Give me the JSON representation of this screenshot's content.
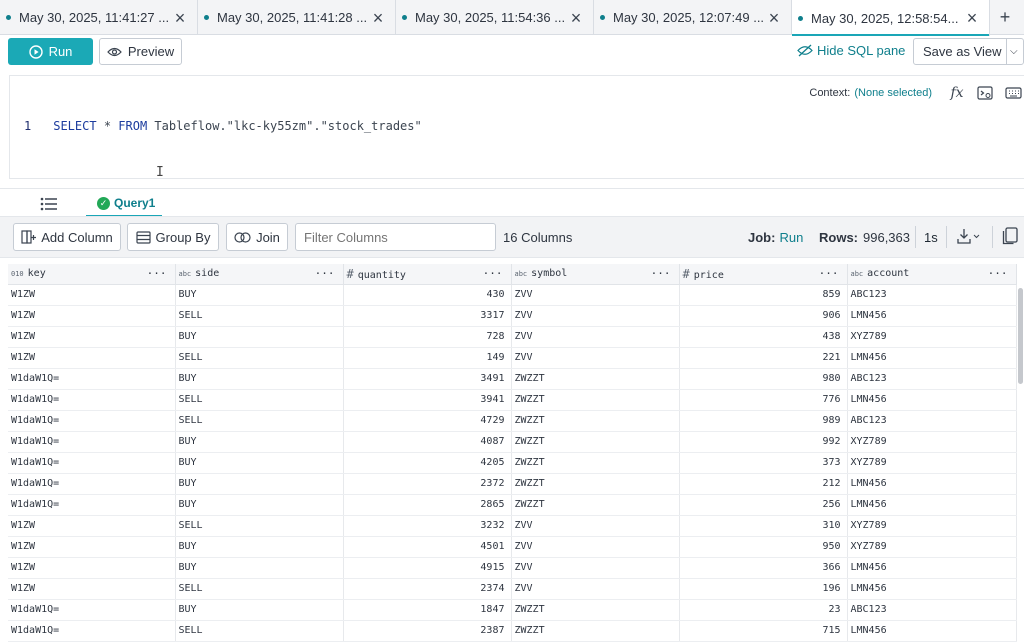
{
  "tabs": [
    {
      "label": "May 30, 2025, 11:41:27 ...",
      "active": false
    },
    {
      "label": "May 30, 2025, 11:41:28 ...",
      "active": false
    },
    {
      "label": "May 30, 2025, 11:54:36 ...",
      "active": false
    },
    {
      "label": "May 30, 2025, 12:07:49 ...",
      "active": false
    },
    {
      "label": "May 30, 2025, 12:58:54...",
      "active": true
    }
  ],
  "toolbar": {
    "run_label": "Run",
    "preview_label": "Preview",
    "hide_sql_label": "Hide SQL pane",
    "save_view_label": "Save as View"
  },
  "editor": {
    "context_label": "Context:",
    "context_value": "(None selected)",
    "line_number": "1",
    "sql_keyword_select": "SELECT",
    "sql_star": " * ",
    "sql_keyword_from": "FROM",
    "sql_rest": " Tableflow.\"lkc-ky55zm\".\"stock_trades\""
  },
  "result_tabs": {
    "query_tab_label": "Query1"
  },
  "results_bar": {
    "add_column_label": "Add Column",
    "group_by_label": "Group By",
    "join_label": "Join",
    "filter_placeholder": "Filter Columns",
    "columns_count_label": "16 Columns",
    "job_label": "Job:",
    "job_status": "Run",
    "rows_label": "Rows:",
    "rows_value": "996,363",
    "time_label": "1s"
  },
  "table": {
    "columns": [
      {
        "type_badge": "010",
        "name": "key"
      },
      {
        "type_badge": "abc",
        "name": "side"
      },
      {
        "type_badge": "#",
        "name": "quantity"
      },
      {
        "type_badge": "abc",
        "name": "symbol"
      },
      {
        "type_badge": "#",
        "name": "price"
      },
      {
        "type_badge": "abc",
        "name": "account"
      }
    ],
    "rows": [
      [
        "W1ZW",
        "BUY",
        "430",
        "ZVV",
        "859",
        "ABC123"
      ],
      [
        "W1ZW",
        "SELL",
        "3317",
        "ZVV",
        "906",
        "LMN456"
      ],
      [
        "W1ZW",
        "BUY",
        "728",
        "ZVV",
        "438",
        "XYZ789"
      ],
      [
        "W1ZW",
        "SELL",
        "149",
        "ZVV",
        "221",
        "LMN456"
      ],
      [
        "W1daW1Q=",
        "BUY",
        "3491",
        "ZWZZT",
        "980",
        "ABC123"
      ],
      [
        "W1daW1Q=",
        "SELL",
        "3941",
        "ZWZZT",
        "776",
        "LMN456"
      ],
      [
        "W1daW1Q=",
        "SELL",
        "4729",
        "ZWZZT",
        "989",
        "ABC123"
      ],
      [
        "W1daW1Q=",
        "BUY",
        "4087",
        "ZWZZT",
        "992",
        "XYZ789"
      ],
      [
        "W1daW1Q=",
        "BUY",
        "4205",
        "ZWZZT",
        "373",
        "XYZ789"
      ],
      [
        "W1daW1Q=",
        "BUY",
        "2372",
        "ZWZZT",
        "212",
        "LMN456"
      ],
      [
        "W1daW1Q=",
        "BUY",
        "2865",
        "ZWZZT",
        "256",
        "LMN456"
      ],
      [
        "W1ZW",
        "SELL",
        "3232",
        "ZVV",
        "310",
        "XYZ789"
      ],
      [
        "W1ZW",
        "BUY",
        "4501",
        "ZVV",
        "950",
        "XYZ789"
      ],
      [
        "W1ZW",
        "BUY",
        "4915",
        "ZVV",
        "366",
        "LMN456"
      ],
      [
        "W1ZW",
        "SELL",
        "2374",
        "ZVV",
        "196",
        "LMN456"
      ],
      [
        "W1daW1Q=",
        "BUY",
        "1847",
        "ZWZZT",
        "23",
        "ABC123"
      ],
      [
        "W1daW1Q=",
        "SELL",
        "2387",
        "ZWZZT",
        "715",
        "LMN456"
      ]
    ]
  },
  "colors": {
    "accent": "#1ba9b6",
    "link": "#0f7f8c",
    "success": "#22a857"
  },
  "icons": [
    "close-icon",
    "play-icon",
    "eye-icon",
    "eye-off-icon",
    "chevron-down-icon",
    "function-icon",
    "terminal-icon",
    "keyboard-icon",
    "list-icon",
    "check-icon",
    "add-column-icon",
    "group-by-icon",
    "join-icon",
    "download-icon",
    "duplicate-icon",
    "more-icon"
  ]
}
